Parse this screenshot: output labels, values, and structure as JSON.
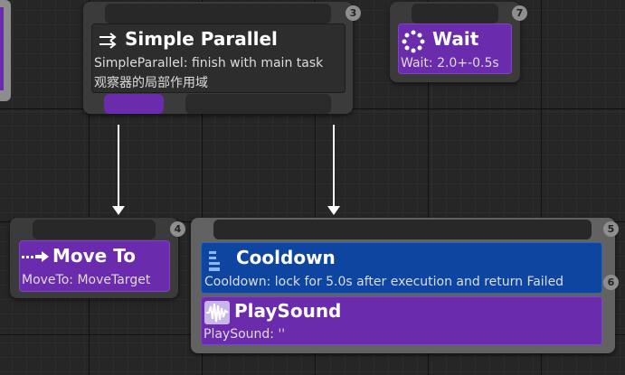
{
  "nodes": {
    "simple_parallel": {
      "badge": "3",
      "title": "Simple Parallel",
      "line1": "SimpleParallel: finish with main task",
      "line2": "观察器的局部作用域",
      "icon": "parallel-arrows-icon"
    },
    "wait": {
      "badge": "7",
      "title": "Wait",
      "subtitle": "Wait: 2.0+-0.5s",
      "icon": "wait-dots-icon"
    },
    "move_to": {
      "badge": "4",
      "title": "Move To",
      "subtitle": "MoveTo: MoveTarget",
      "icon": "move-arrow-icon"
    },
    "sequence_box": {
      "badge": "5"
    },
    "cooldown": {
      "badge": "6",
      "title": "Cooldown",
      "subtitle": "Cooldown: lock for 5.0s after execution and return Failed",
      "icon": "cooldown-bars-icon"
    },
    "play_sound": {
      "title": "PlaySound",
      "subtitle": "PlaySound: ''",
      "icon": "sound-wave-icon"
    }
  },
  "colors": {
    "task_purple": "#6a2bad",
    "decorator_blue": "#0d45a0",
    "graph_bg": "#262626"
  }
}
